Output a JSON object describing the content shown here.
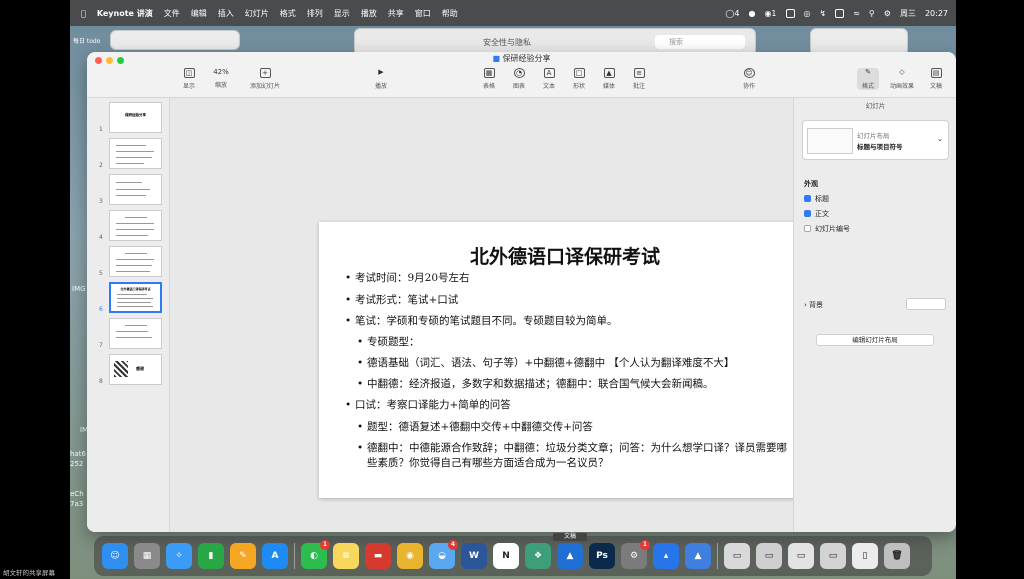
{
  "menubar": {
    "app_name": "Keynote 讲演",
    "items": [
      "文件",
      "编辑",
      "插入",
      "幻灯片",
      "格式",
      "排列",
      "显示",
      "播放",
      "共享",
      "窗口",
      "帮助"
    ],
    "status": {
      "notif_count": "4",
      "wechat_count": "1",
      "day": "周三",
      "time": "20:27"
    }
  },
  "back_windows": {
    "security_title": "安全性与隐私",
    "search_placeholder": "搜索",
    "left_label": "每日 todo"
  },
  "side_labels": [
    "IMG",
    "IM",
    "hat6",
    "252",
    "eCh",
    "7a3"
  ],
  "window": {
    "title": "保研经验分享",
    "toolbar": {
      "zoom": "42%",
      "items": [
        {
          "id": "view",
          "label": "显示"
        },
        {
          "id": "zoom",
          "label": "缩放"
        },
        {
          "id": "add-slide",
          "label": "添加幻灯片"
        },
        {
          "id": "play",
          "label": "播放"
        },
        {
          "id": "table",
          "label": "表格"
        },
        {
          "id": "chart",
          "label": "图表"
        },
        {
          "id": "text",
          "label": "文本"
        },
        {
          "id": "shape",
          "label": "形状"
        },
        {
          "id": "media",
          "label": "媒体"
        },
        {
          "id": "comment",
          "label": "批注"
        },
        {
          "id": "collaborate",
          "label": "协作"
        },
        {
          "id": "format",
          "label": "格式"
        },
        {
          "id": "animate",
          "label": "动画效果"
        },
        {
          "id": "document",
          "label": "文稿"
        }
      ]
    }
  },
  "navigator": {
    "slides": [
      {
        "num": "1",
        "title": "保研经验分享"
      },
      {
        "num": "2",
        "title": ""
      },
      {
        "num": "3",
        "title": ""
      },
      {
        "num": "4",
        "title": ""
      },
      {
        "num": "5",
        "title": ""
      },
      {
        "num": "6",
        "title": "北外德语口译保研考试"
      },
      {
        "num": "7",
        "title": ""
      },
      {
        "num": "8",
        "title": "感谢"
      }
    ],
    "selected": "6"
  },
  "slide": {
    "title": "北外德语口译保研考试",
    "bullets": [
      {
        "level": 1,
        "text": "考试时间：9月20号左右"
      },
      {
        "level": 1,
        "text": "考试形式：笔试+口试"
      },
      {
        "level": 1,
        "text": "笔试：学硕和专硕的笔试题目不同。专硕题目较为简单。"
      },
      {
        "level": 2,
        "text": "专硕题型："
      },
      {
        "level": 2,
        "text": "德语基础（词汇、语法、句子等）+中翻德+德翻中 【个人认为翻译难度不大】"
      },
      {
        "level": 2,
        "text": "中翻德：经济报道，多数字和数据描述；德翻中：联合国气候大会新闻稿。"
      },
      {
        "level": 1,
        "text": "口试：考察口译能力+简单的问答"
      },
      {
        "level": 2,
        "text": "题型：德语复述+德翻中交传+中翻德交传+问答"
      },
      {
        "level": 2,
        "text": "德翻中：中德能源合作致辞；中翻德：垃圾分类文章；问答：为什么想学口译？译员需要哪些素质？你觉得自己有哪些方面适合成为一名议员？"
      }
    ]
  },
  "inspector": {
    "header": "幻灯片",
    "layout_caption": "幻灯片布局",
    "layout_name": "标题与项目符号",
    "appearance": "外观",
    "checks": [
      {
        "label": "标题",
        "checked": true
      },
      {
        "label": "正文",
        "checked": true
      },
      {
        "label": "幻灯片编号",
        "checked": false
      }
    ],
    "background": "背景",
    "edit_layout": "编辑幻灯片布局"
  },
  "dock": {
    "apps": [
      {
        "id": "finder",
        "glyph": "☺",
        "color": "#2f8ff0"
      },
      {
        "id": "launchpad",
        "glyph": "▦",
        "color": "#8a8a8a"
      },
      {
        "id": "safari",
        "glyph": "✧",
        "color": "#3b9cf5"
      },
      {
        "id": "numbers",
        "glyph": "▮",
        "color": "#27a745"
      },
      {
        "id": "pages",
        "glyph": "✎",
        "color": "#f5a623"
      },
      {
        "id": "appstore",
        "glyph": "A",
        "color": "#1d8bf1"
      },
      {
        "id": "wechat",
        "glyph": "◐",
        "color": "#2dbd4e",
        "badge": "1"
      },
      {
        "id": "notes",
        "glyph": "≡",
        "color": "#f7d85c"
      },
      {
        "id": "translator",
        "glyph": "▬",
        "color": "#d63a2f"
      },
      {
        "id": "chrome",
        "glyph": "◉",
        "color": "#e9b52f"
      },
      {
        "id": "qq",
        "glyph": "◒",
        "color": "#5aa8f0",
        "badge": "4"
      },
      {
        "id": "word",
        "glyph": "W",
        "color": "#2b579a"
      },
      {
        "id": "notion",
        "glyph": "N",
        "color": "#ffffff"
      },
      {
        "id": "bookmarks",
        "glyph": "❖",
        "color": "#3c9f7a"
      },
      {
        "id": "keynote",
        "glyph": "▲",
        "color": "#1f6fd6",
        "label": "文稿"
      },
      {
        "id": "photoshop",
        "glyph": "Ps",
        "color": "#0b2a4a"
      },
      {
        "id": "settings",
        "glyph": "⚙",
        "color": "#7b7b7b",
        "badge": "1"
      },
      {
        "id": "lanhu",
        "glyph": "▴",
        "color": "#2775e8"
      },
      {
        "id": "keynote2",
        "glyph": "▲",
        "color": "#3f7fe0"
      },
      {
        "id": "win1",
        "glyph": "▭",
        "color": "#d9d9d9"
      },
      {
        "id": "win2",
        "glyph": "▭",
        "color": "#cfcfcf"
      },
      {
        "id": "win3",
        "glyph": "▭",
        "color": "#e3e3e3"
      },
      {
        "id": "win4",
        "glyph": "▭",
        "color": "#d3d3d3"
      },
      {
        "id": "win5",
        "glyph": "▯",
        "color": "#ececec"
      },
      {
        "id": "trash",
        "glyph": "🗑",
        "color": "#bfbfbf"
      }
    ]
  },
  "footer": {
    "share_label": "胡文轩的共享屏幕"
  }
}
